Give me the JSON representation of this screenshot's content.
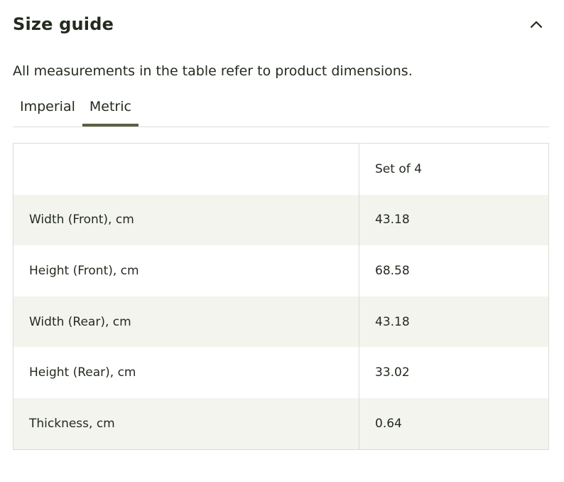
{
  "header": {
    "title": "Size guide",
    "collapse_icon": "chevron-up-icon"
  },
  "description": "All measurements in the table refer to product dimensions.",
  "tabs": [
    {
      "label": "Imperial",
      "active": false
    },
    {
      "label": "Metric",
      "active": true
    }
  ],
  "table": {
    "header": {
      "label": "",
      "value": "Set of 4"
    },
    "rows": [
      {
        "label": "Width (Front), cm",
        "value": "43.18"
      },
      {
        "label": "Height (Front), cm",
        "value": "68.58"
      },
      {
        "label": "Width (Rear), cm",
        "value": "43.18"
      },
      {
        "label": "Height (Rear), cm",
        "value": "33.02"
      },
      {
        "label": "Thickness, cm",
        "value": "0.64"
      }
    ]
  },
  "colors": {
    "text": "#232b1f",
    "active_tab_underline": "#5e5e46",
    "row_shade": "#f4f4ef",
    "border": "#dcdcd6"
  }
}
